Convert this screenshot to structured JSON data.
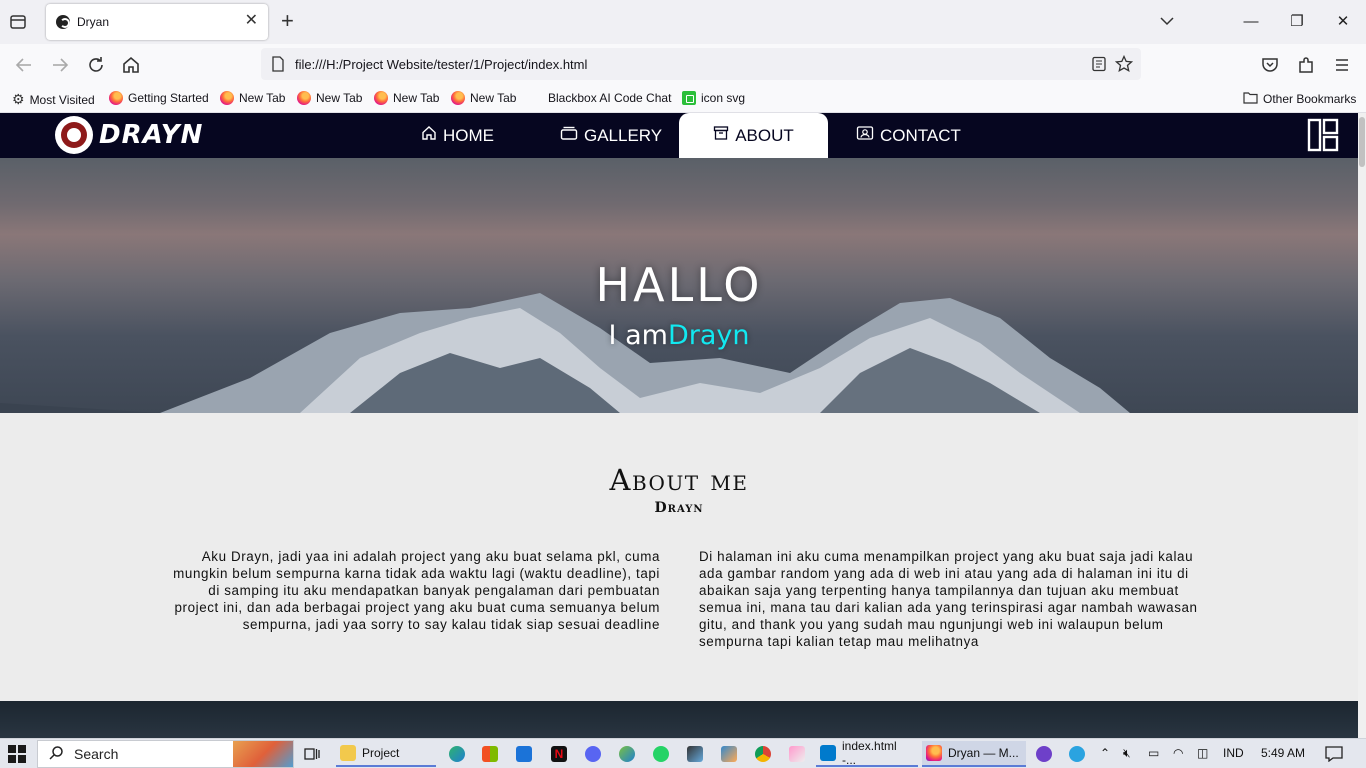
{
  "browser": {
    "tab_title": "Dryan",
    "new_tab_symbol": "+",
    "url": "file:///H:/Project Website/tester/1/Project/index.html",
    "window_controls": {
      "minimize": "—",
      "maximize": "❐",
      "close": "✕"
    },
    "bookmarks": [
      {
        "label": "Most Visited",
        "icon": "gear-icon"
      },
      {
        "label": "Getting Started",
        "icon": "firefox-icon"
      },
      {
        "label": "New Tab",
        "icon": "firefox-icon"
      },
      {
        "label": "New Tab",
        "icon": "firefox-icon"
      },
      {
        "label": "New Tab",
        "icon": "firefox-icon"
      },
      {
        "label": "New Tab",
        "icon": "firefox-icon"
      },
      {
        "label": "Blackbox AI Code Chat",
        "icon": "none"
      },
      {
        "label": "icon svg",
        "icon": "green-square-icon"
      }
    ],
    "other_bookmarks": "Other Bookmarks"
  },
  "site": {
    "logo_text": "DRAYN",
    "nav": [
      {
        "label": "HOME",
        "icon": "home-icon",
        "active": false
      },
      {
        "label": "GALLERY",
        "icon": "gallery-icon",
        "active": false
      },
      {
        "label": "ABOUT",
        "icon": "archive-icon",
        "active": true
      },
      {
        "label": "CONTACT",
        "icon": "contact-card-icon",
        "active": false
      }
    ],
    "hero": {
      "title": "HALLO",
      "subtitle_prefix": "I am",
      "subtitle_name": "Drayn"
    },
    "about": {
      "title": "About me",
      "subtitle": "Drayn",
      "left_text": "Aku Drayn, jadi yaa ini adalah project yang aku buat selama pkl, cuma mungkin belum sempurna karna tidak ada waktu lagi (waktu deadline), tapi di samping itu aku mendapatkan banyak pengalaman dari pembuatan project ini, dan ada berbagai project yang aku buat cuma semuanya belum sempurna, jadi yaa sorry to say kalau tidak siap sesuai deadline",
      "right_text": "Di halaman ini aku cuma menampilkan project yang aku buat saja jadi kalau ada gambar random yang ada di web ini atau yang ada di halaman ini itu di abaikan saja yang terpenting hanya tampilannya dan tujuan aku membuat semua ini, mana tau dari kalian ada yang terinspirasi agar nambah wawasan gitu, and thank you yang sudah mau ngunjungi web ini walaupun belum sempurna tapi kalian tetap mau melihatnya"
    },
    "colors": {
      "nav_bg": "#060620",
      "accent": "#12e8f0"
    }
  },
  "taskbar": {
    "search_label": "Search",
    "apps": [
      {
        "label": "Project",
        "icon": "folder-icon"
      },
      {
        "label": "index.html -...",
        "icon": "vscode-icon"
      },
      {
        "label": "Dryan — M...",
        "icon": "firefox-icon"
      }
    ],
    "language": "IND",
    "time": "5:49 AM"
  }
}
